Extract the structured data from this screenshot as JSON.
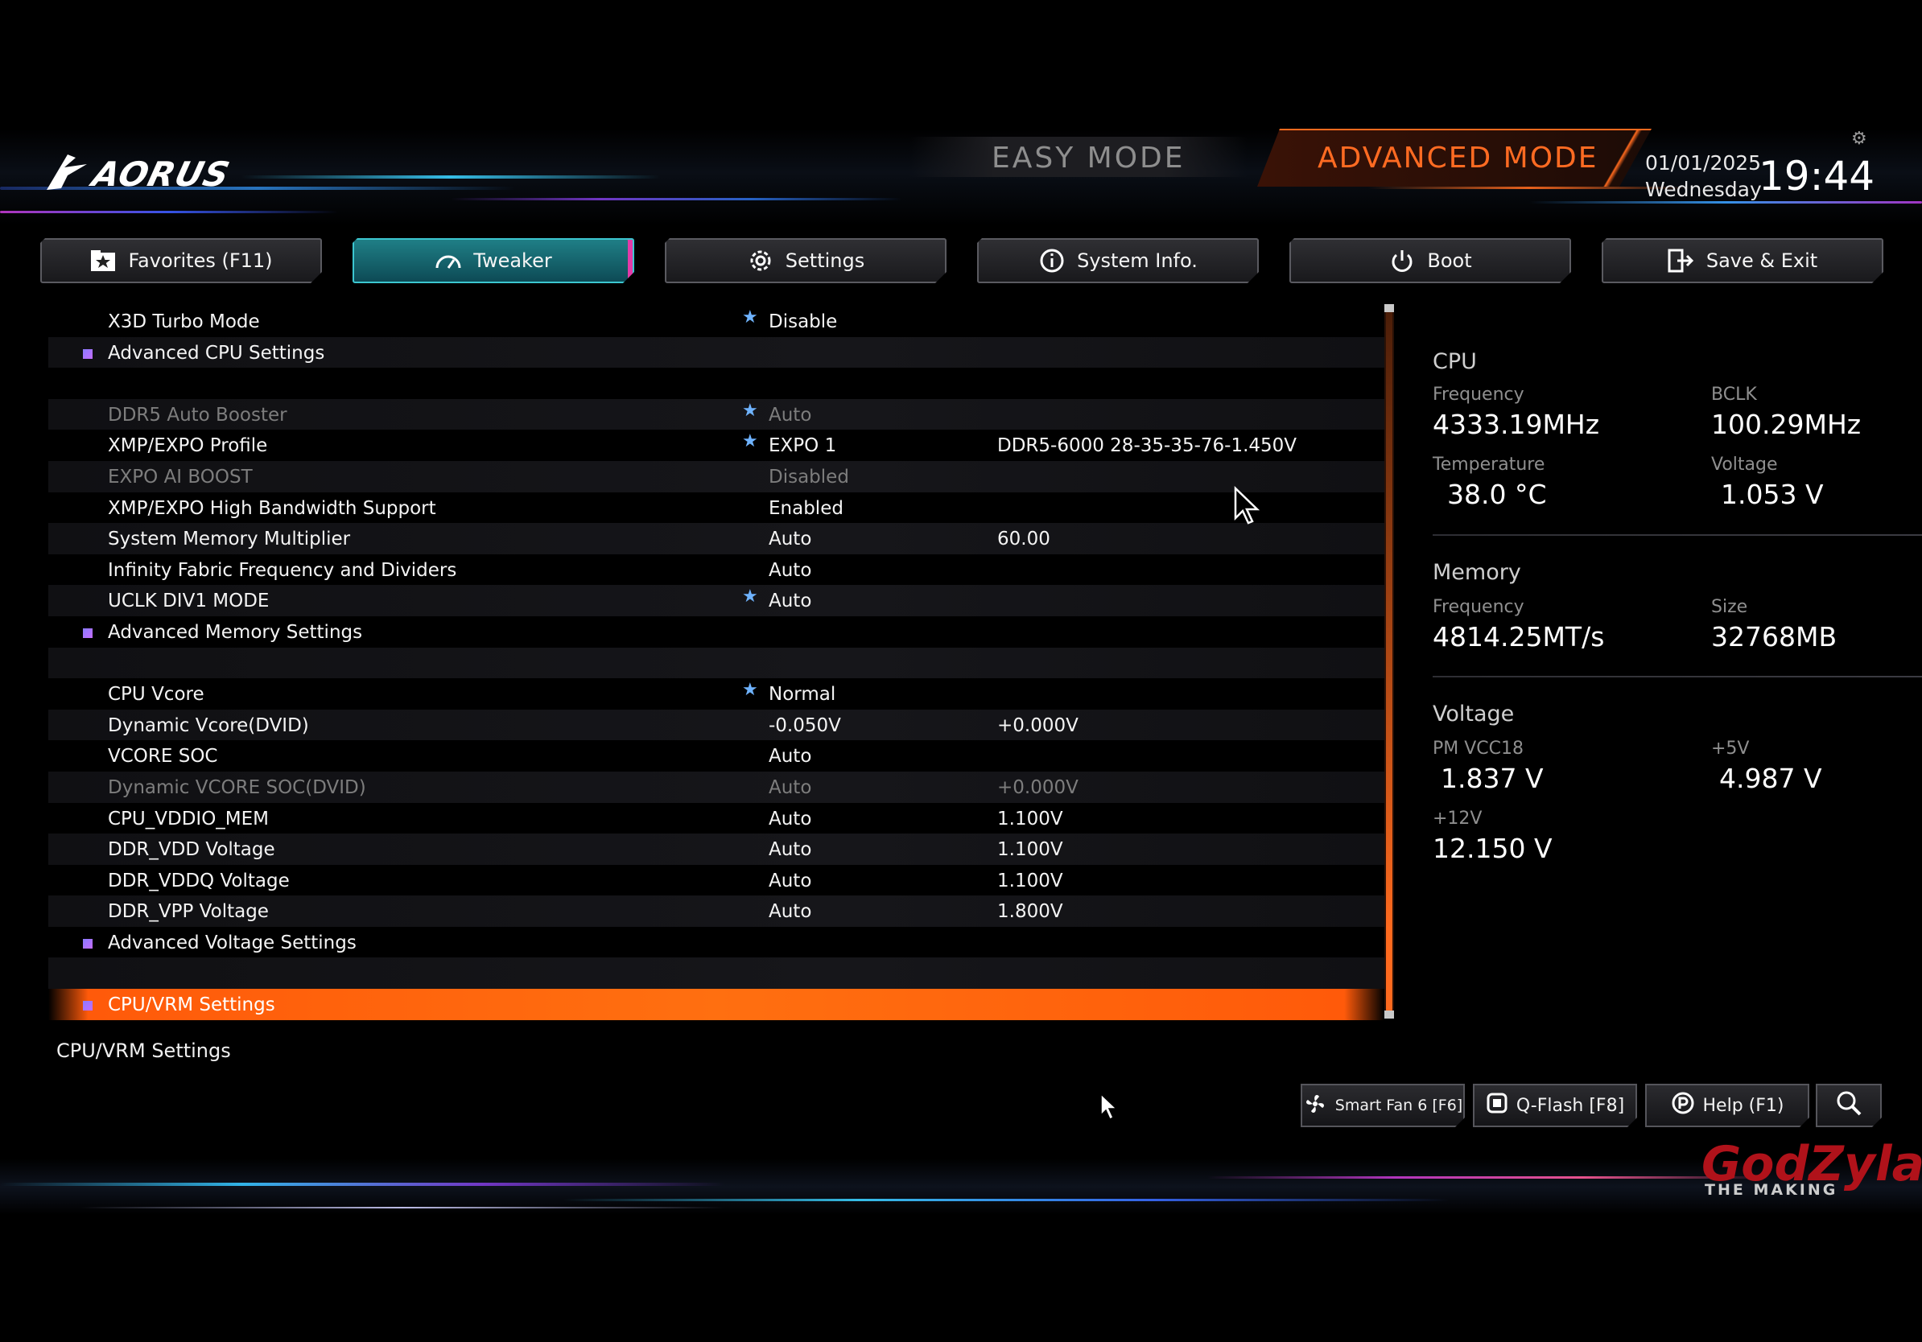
{
  "header": {
    "logo": "AORUS",
    "easy_mode": "EASY MODE",
    "advanced_mode": "ADVANCED MODE",
    "date": "01/01/2025",
    "weekday": "Wednesday",
    "time": "19:44"
  },
  "tabs": [
    {
      "label": "Favorites (F11)",
      "icon": "star-folder-icon"
    },
    {
      "label": "Tweaker",
      "icon": "speedometer-icon"
    },
    {
      "label": "Settings",
      "icon": "gear-icon"
    },
    {
      "label": "System Info.",
      "icon": "info-icon"
    },
    {
      "label": "Boot",
      "icon": "power-icon"
    },
    {
      "label": "Save & Exit",
      "icon": "exit-icon"
    }
  ],
  "settings": [
    {
      "label": "X3D Turbo Mode",
      "star": true,
      "value": "Disable",
      "extra": ""
    },
    {
      "label": "Advanced CPU Settings",
      "submenu": true
    },
    {
      "label": "",
      "blank": true
    },
    {
      "label": "DDR5 Auto Booster",
      "star": true,
      "value": "Auto",
      "extra": "",
      "dim": true
    },
    {
      "label": "XMP/EXPO Profile",
      "star": true,
      "value": "EXPO 1",
      "extra": "DDR5-6000 28-35-35-76-1.450V"
    },
    {
      "label": "EXPO AI BOOST",
      "value": "Disabled",
      "extra": "",
      "dim": true
    },
    {
      "label": "XMP/EXPO High Bandwidth Support",
      "value": "Enabled",
      "extra": ""
    },
    {
      "label": "System Memory Multiplier",
      "value": "Auto",
      "extra": "60.00"
    },
    {
      "label": "Infinity Fabric Frequency and Dividers",
      "value": "Auto",
      "extra": ""
    },
    {
      "label": "UCLK DIV1 MODE",
      "star": true,
      "value": "Auto",
      "extra": ""
    },
    {
      "label": "Advanced Memory Settings",
      "submenu": true
    },
    {
      "label": "",
      "blank": true
    },
    {
      "label": "CPU Vcore",
      "star": true,
      "value": "Normal",
      "extra": ""
    },
    {
      "label": "Dynamic Vcore(DVID)",
      "value": "-0.050V",
      "extra": "+0.000V"
    },
    {
      "label": "VCORE SOC",
      "value": "Auto",
      "extra": ""
    },
    {
      "label": "Dynamic VCORE SOC(DVID)",
      "value": "Auto",
      "extra": "+0.000V",
      "dim": true
    },
    {
      "label": "CPU_VDDIO_MEM",
      "value": "Auto",
      "extra": "1.100V"
    },
    {
      "label": "DDR_VDD Voltage",
      "value": "Auto",
      "extra": "1.100V"
    },
    {
      "label": "DDR_VDDQ Voltage",
      "value": "Auto",
      "extra": "1.100V"
    },
    {
      "label": "DDR_VPP Voltage",
      "value": "Auto",
      "extra": "1.800V"
    },
    {
      "label": "Advanced Voltage Settings",
      "submenu": true
    },
    {
      "label": "",
      "blank": true
    },
    {
      "label": "CPU/VRM Settings",
      "submenu": true,
      "selected": true
    }
  ],
  "help_text": "CPU/VRM Settings",
  "info": {
    "cpu": {
      "title": "CPU",
      "freq_label": "Frequency",
      "freq": "4333.19MHz",
      "bclk_label": "BCLK",
      "bclk": "100.29MHz",
      "temp_label": "Temperature",
      "temp": "38.0 °C",
      "volt_label": "Voltage",
      "volt": "1.053 V"
    },
    "memory": {
      "title": "Memory",
      "freq_label": "Frequency",
      "freq": "4814.25MT/s",
      "size_label": "Size",
      "size": "32768MB"
    },
    "voltage": {
      "title": "Voltage",
      "vcc18_label": "PM VCC18",
      "vcc18": "1.837 V",
      "v5_label": "+5V",
      "v5": "4.987 V",
      "v12_label": "+12V",
      "v12": "12.150 V"
    }
  },
  "bottom_buttons": {
    "smart_fan": "Smart Fan 6 [F6]",
    "qflash": "Q-Flash [F8]",
    "help": "Help (F1)"
  },
  "watermark": {
    "main": "GodZyla",
    "sub": "THE MAKING"
  },
  "colors": {
    "accent": "#ff6a1e",
    "active_tab": "#1f7f86",
    "star": "#6fb3ff"
  }
}
